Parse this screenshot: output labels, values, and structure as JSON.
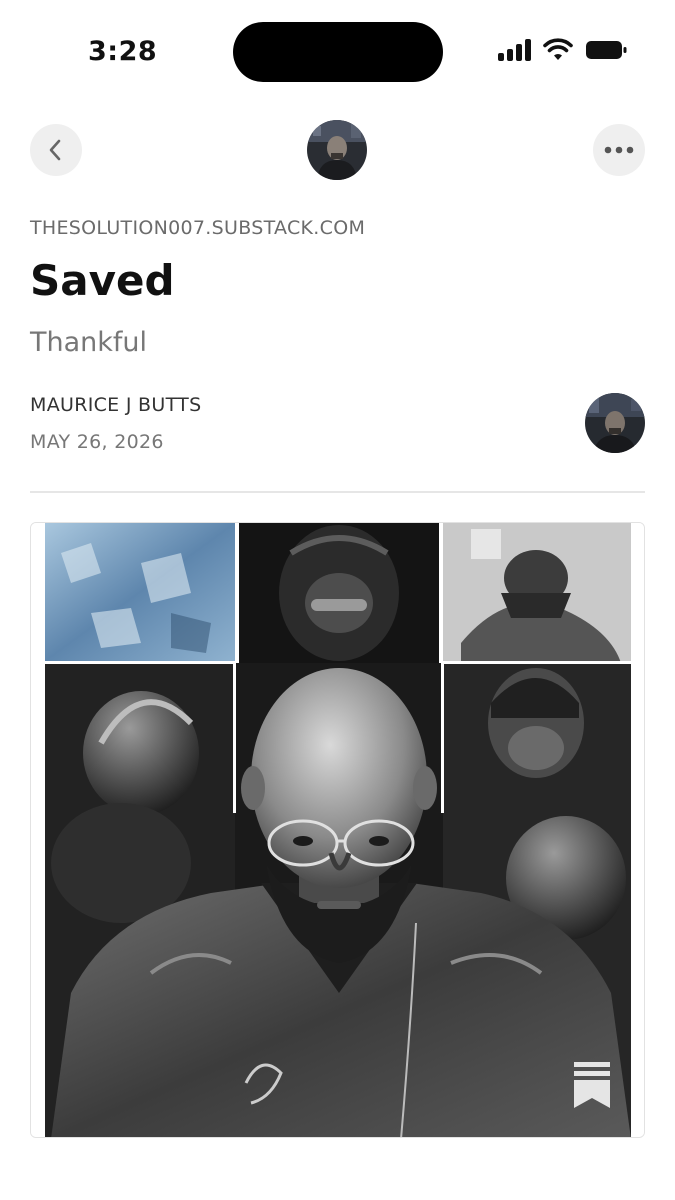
{
  "status_bar": {
    "time": "3:28"
  },
  "nav": {
    "back_icon": "chevron-left-icon",
    "more_icon": "ellipsis-icon"
  },
  "post": {
    "publication": "THESOLUTION007.SUBSTACK.COM",
    "title": "Saved",
    "subtitle": "Thankful",
    "author": "MAURICE J BUTTS",
    "date": "MAY 26, 2026"
  },
  "colors": {
    "background": "#ffffff",
    "title": "#111111",
    "muted": "#777777",
    "button_bg": "#efefef"
  }
}
